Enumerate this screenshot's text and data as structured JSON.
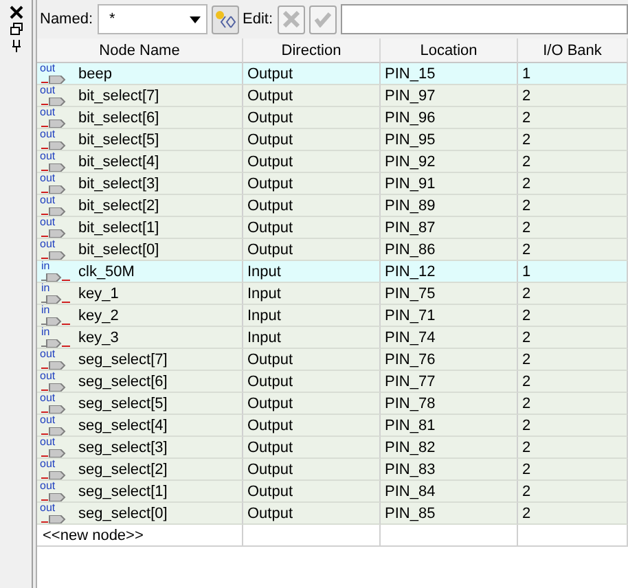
{
  "toolbar": {
    "named_label": "Named:",
    "named_value": "*",
    "edit_label": "Edit:"
  },
  "table": {
    "columns": [
      "Node Name",
      "Direction",
      "Location",
      "I/O Bank"
    ],
    "rows": [
      {
        "kind": "output",
        "pin_label": "out",
        "name": "beep",
        "direction": "Output",
        "location": "PIN_15",
        "bank": "1",
        "highlighted": true
      },
      {
        "kind": "output",
        "pin_label": "out",
        "name": "bit_select[7]",
        "direction": "Output",
        "location": "PIN_97",
        "bank": "2",
        "highlighted": false
      },
      {
        "kind": "output",
        "pin_label": "out",
        "name": "bit_select[6]",
        "direction": "Output",
        "location": "PIN_96",
        "bank": "2",
        "highlighted": false
      },
      {
        "kind": "output",
        "pin_label": "out",
        "name": "bit_select[5]",
        "direction": "Output",
        "location": "PIN_95",
        "bank": "2",
        "highlighted": false
      },
      {
        "kind": "output",
        "pin_label": "out",
        "name": "bit_select[4]",
        "direction": "Output",
        "location": "PIN_92",
        "bank": "2",
        "highlighted": false
      },
      {
        "kind": "output",
        "pin_label": "out",
        "name": "bit_select[3]",
        "direction": "Output",
        "location": "PIN_91",
        "bank": "2",
        "highlighted": false
      },
      {
        "kind": "output",
        "pin_label": "out",
        "name": "bit_select[2]",
        "direction": "Output",
        "location": "PIN_89",
        "bank": "2",
        "highlighted": false
      },
      {
        "kind": "output",
        "pin_label": "out",
        "name": "bit_select[1]",
        "direction": "Output",
        "location": "PIN_87",
        "bank": "2",
        "highlighted": false
      },
      {
        "kind": "output",
        "pin_label": "out",
        "name": "bit_select[0]",
        "direction": "Output",
        "location": "PIN_86",
        "bank": "2",
        "highlighted": false
      },
      {
        "kind": "input",
        "pin_label": "in",
        "name": "clk_50M",
        "direction": "Input",
        "location": "PIN_12",
        "bank": "1",
        "highlighted": true
      },
      {
        "kind": "input",
        "pin_label": "in",
        "name": "key_1",
        "direction": "Input",
        "location": "PIN_75",
        "bank": "2",
        "highlighted": false
      },
      {
        "kind": "input",
        "pin_label": "in",
        "name": "key_2",
        "direction": "Input",
        "location": "PIN_71",
        "bank": "2",
        "highlighted": false
      },
      {
        "kind": "input",
        "pin_label": "in",
        "name": "key_3",
        "direction": "Input",
        "location": "PIN_74",
        "bank": "2",
        "highlighted": false
      },
      {
        "kind": "output",
        "pin_label": "out",
        "name": "seg_select[7]",
        "direction": "Output",
        "location": "PIN_76",
        "bank": "2",
        "highlighted": false
      },
      {
        "kind": "output",
        "pin_label": "out",
        "name": "seg_select[6]",
        "direction": "Output",
        "location": "PIN_77",
        "bank": "2",
        "highlighted": false
      },
      {
        "kind": "output",
        "pin_label": "out",
        "name": "seg_select[5]",
        "direction": "Output",
        "location": "PIN_78",
        "bank": "2",
        "highlighted": false
      },
      {
        "kind": "output",
        "pin_label": "out",
        "name": "seg_select[4]",
        "direction": "Output",
        "location": "PIN_81",
        "bank": "2",
        "highlighted": false
      },
      {
        "kind": "output",
        "pin_label": "out",
        "name": "seg_select[3]",
        "direction": "Output",
        "location": "PIN_82",
        "bank": "2",
        "highlighted": false
      },
      {
        "kind": "output",
        "pin_label": "out",
        "name": "seg_select[2]",
        "direction": "Output",
        "location": "PIN_83",
        "bank": "2",
        "highlighted": false
      },
      {
        "kind": "output",
        "pin_label": "out",
        "name": "seg_select[1]",
        "direction": "Output",
        "location": "PIN_84",
        "bank": "2",
        "highlighted": false
      },
      {
        "kind": "output",
        "pin_label": "out",
        "name": "seg_select[0]",
        "direction": "Output",
        "location": "PIN_85",
        "bank": "2",
        "highlighted": false
      }
    ],
    "new_node": "<<new node>>"
  }
}
